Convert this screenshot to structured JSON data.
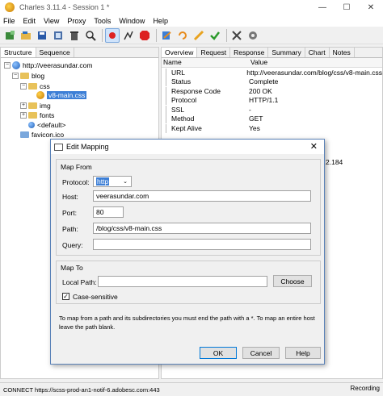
{
  "window": {
    "title": "Charles 3.11.4 - Session 1 *",
    "controls": [
      "—",
      "☐",
      "✕"
    ]
  },
  "menu": [
    "File",
    "Edit",
    "View",
    "Proxy",
    "Tools",
    "Window",
    "Help"
  ],
  "left": {
    "tabs": [
      "Structure",
      "Sequence"
    ],
    "tree": {
      "root": "http://veerasundar.com",
      "blog": "blog",
      "css": "css",
      "file": "v8-main.css",
      "img": "img",
      "fonts": "fonts",
      "default": "<default>",
      "favicon": "favicon.ico"
    }
  },
  "right": {
    "tabs": [
      "Overview",
      "Request",
      "Response",
      "Summary",
      "Chart",
      "Notes"
    ],
    "col_name": "Name",
    "col_value": "Value",
    "rows": [
      {
        "k": "URL",
        "v": "http://veerasundar.com/blog/css/v8-main.css"
      },
      {
        "k": "Status",
        "v": "Complete"
      },
      {
        "k": "Response Code",
        "v": "200 OK"
      },
      {
        "k": "Protocol",
        "v": "HTTP/1.1"
      },
      {
        "k": "SSL",
        "v": "-"
      },
      {
        "k": "Method",
        "v": "GET"
      },
      {
        "k": "Kept Alive",
        "v": "Yes"
      }
    ],
    "ip_fragment": "2.184"
  },
  "dialog": {
    "title": "Edit Mapping",
    "map_from": "Map From",
    "protocol_label": "Protocol:",
    "protocol_value": "http",
    "host_label": "Host:",
    "host_value": "veerasundar.com",
    "port_label": "Port:",
    "port_value": "80",
    "path_label": "Path:",
    "path_value": "/blog/css/v8-main.css",
    "query_label": "Query:",
    "query_value": "",
    "map_to": "Map To",
    "local_path_label": "Local Path:",
    "local_path_value": "",
    "choose": "Choose",
    "case_sensitive": "Case-sensitive",
    "note": "To map from a path and its subdirectories you must end the path with a *. To map an entire host leave the path blank.",
    "ok": "OK",
    "cancel": "Cancel",
    "help": "Help"
  },
  "status": {
    "text": "CONNECT https://scss-prod-an1-notif-6.adobesc.com:443",
    "recording": "Recording"
  }
}
